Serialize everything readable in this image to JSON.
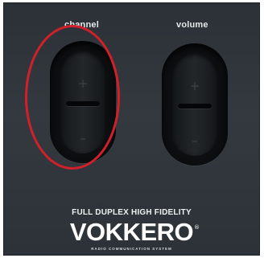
{
  "controls": {
    "channel": {
      "label": "channel",
      "plus": "+",
      "minus": "–"
    },
    "volume": {
      "label": "volume",
      "plus": "+",
      "minus": "–"
    }
  },
  "branding": {
    "tagline": "FULL DUPLEX HIGH FIDELITY",
    "brand_name": "VOKKERO",
    "registered_mark": "®",
    "subline": "RADIO COMMUNICATION SYSTEM"
  },
  "highlight": {
    "color": "#d2202a",
    "target": "channel"
  },
  "colors": {
    "panel": "#30363b",
    "text": "#ffffff"
  }
}
